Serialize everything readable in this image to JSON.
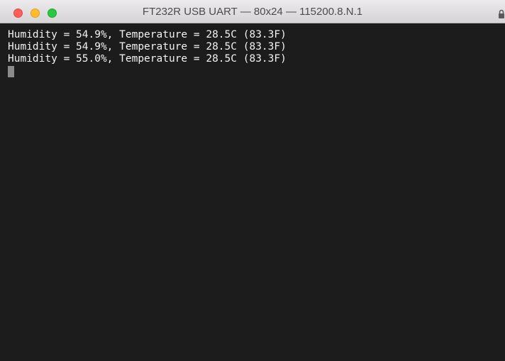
{
  "window": {
    "title": "FT232R USB UART — 80x24 — 115200.8.N.1"
  },
  "icons": {
    "close": "close-button",
    "minimize": "minimize-button",
    "maximize": "zoom-button",
    "lock": "lock-icon"
  },
  "terminal": {
    "lines": [
      "Humidity = 54.9%, Temperature = 28.5C (83.3F)",
      "Humidity = 54.9%, Temperature = 28.5C (83.3F)",
      "Humidity = 55.0%, Temperature = 28.5C (83.3F)"
    ]
  },
  "colors": {
    "terminal_background": "#1c1c1c",
    "terminal_text": "#f2f2f2",
    "cursor": "#8a8a8a",
    "close": "#fe5f58",
    "minimize": "#febc2e",
    "maximize": "#29c840"
  }
}
